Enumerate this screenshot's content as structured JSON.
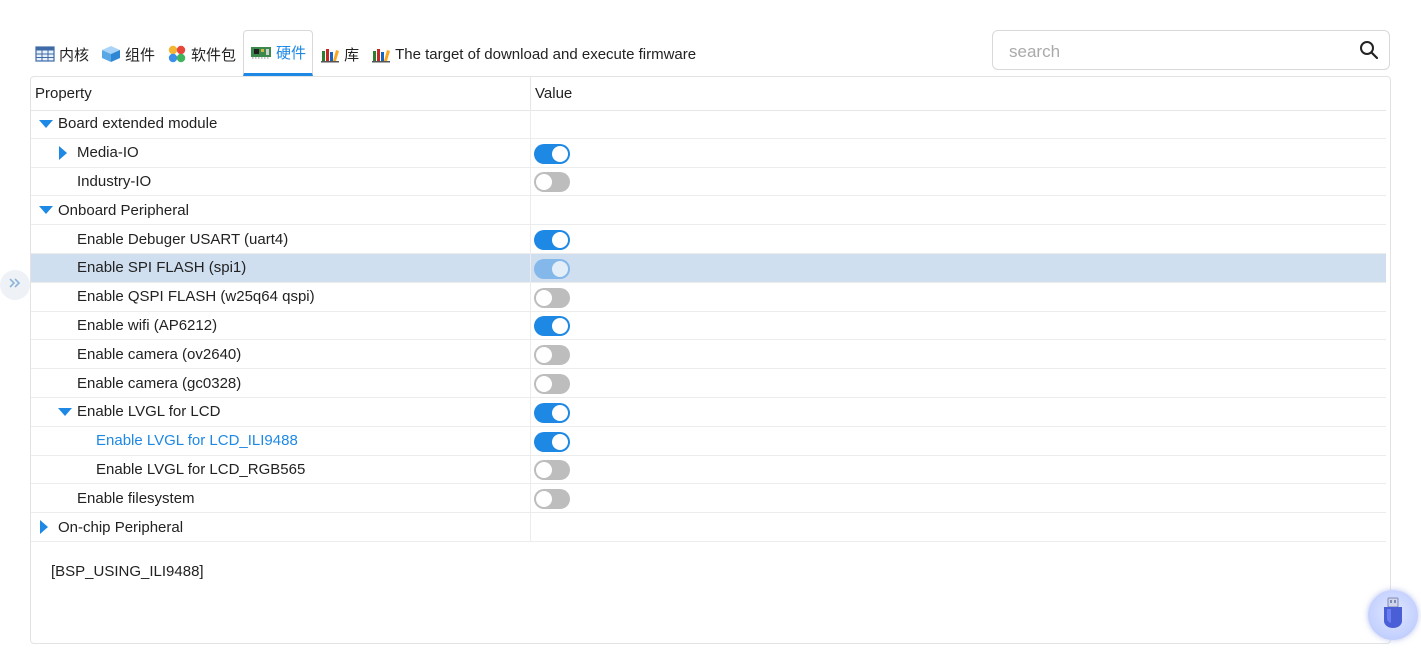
{
  "tabs": [
    {
      "label": "内核",
      "icon": "table-icon",
      "active": false
    },
    {
      "label": "组件",
      "icon": "cube-icon",
      "active": false
    },
    {
      "label": "软件包",
      "icon": "packages-icon",
      "active": false
    },
    {
      "label": "硬件",
      "icon": "board-icon",
      "active": true
    },
    {
      "label": "库",
      "icon": "library-icon",
      "active": false
    },
    {
      "label": "The target of download and execute firmware",
      "icon": "library-icon",
      "active": false
    }
  ],
  "search": {
    "placeholder": "search",
    "value": ""
  },
  "table": {
    "header_property": "Property",
    "header_value": "Value",
    "rows": [
      {
        "label": "Board extended module",
        "caret": "down"
      },
      {
        "label": "Media-IO",
        "caret": "right",
        "toggle": "on"
      },
      {
        "label": "Industry-IO",
        "toggle": "off"
      },
      {
        "label": "Onboard Peripheral",
        "caret": "down"
      },
      {
        "label": "Enable Debuger USART (uart4)",
        "toggle": "on"
      },
      {
        "label": "Enable SPI FLASH (spi1)",
        "toggle": "on-disabled",
        "selected": true
      },
      {
        "label": "Enable QSPI FLASH (w25q64 qspi)",
        "toggle": "off"
      },
      {
        "label": "Enable wifi (AP6212)",
        "toggle": "on"
      },
      {
        "label": "Enable camera (ov2640)",
        "toggle": "off"
      },
      {
        "label": "Enable camera (gc0328)",
        "toggle": "off"
      },
      {
        "label": "Enable LVGL for LCD",
        "caret": "down",
        "toggle": "on"
      },
      {
        "label": "Enable LVGL for LCD_ILI9488",
        "toggle": "on",
        "highlight": true
      },
      {
        "label": "Enable LVGL for LCD_RGB565",
        "toggle": "off"
      },
      {
        "label": "Enable filesystem",
        "toggle": "off"
      },
      {
        "label": "On-chip Peripheral",
        "caret": "right"
      }
    ]
  },
  "description": "[BSP_USING_ILI9488]",
  "colors": {
    "accent": "#1e88e5",
    "selected_row": "#cfdff0",
    "toggle_off": "#bdbdbd"
  }
}
